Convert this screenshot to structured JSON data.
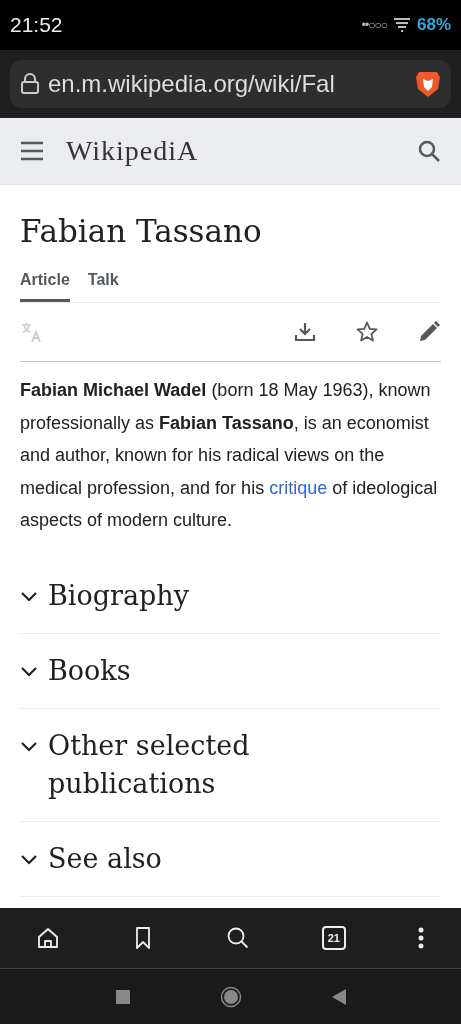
{
  "status_bar": {
    "time": "21:52",
    "signal": "••○○○",
    "battery": "68%"
  },
  "address_bar": {
    "url": "en.m.wikipedia.org/wiki/Fal",
    "secure": true
  },
  "site_header": {
    "logo": "WikipediA"
  },
  "article": {
    "title": "Fabian Tassano",
    "tabs": [
      {
        "label": "Article",
        "selected": true
      },
      {
        "label": "Talk",
        "selected": false
      }
    ],
    "actions": [
      {
        "kind": "translate",
        "disabled": true
      },
      {
        "kind": "download",
        "disabled": false
      },
      {
        "kind": "star",
        "disabled": false
      },
      {
        "kind": "edit",
        "disabled": false
      }
    ],
    "intro": [
      {
        "kind": "text",
        "text": "**Fabian Michael Wadel** (born 18 May 1963), known professionally as **Fabian Tassano**, is an economist and author, known for his radical views on the medical profession, and for his "
      },
      {
        "kind": "link",
        "text": "critique"
      },
      {
        "kind": "text",
        "text": " of ideological aspects of modern culture."
      }
    ],
    "sections": [
      {
        "title": "Biography",
        "expanded": false
      },
      {
        "title": "Books",
        "expanded": false
      },
      {
        "title": "Other selected publications",
        "expanded": false
      },
      {
        "title": "See also",
        "expanded": false
      }
    ]
  },
  "toolbar": {
    "tab_count": "21"
  }
}
